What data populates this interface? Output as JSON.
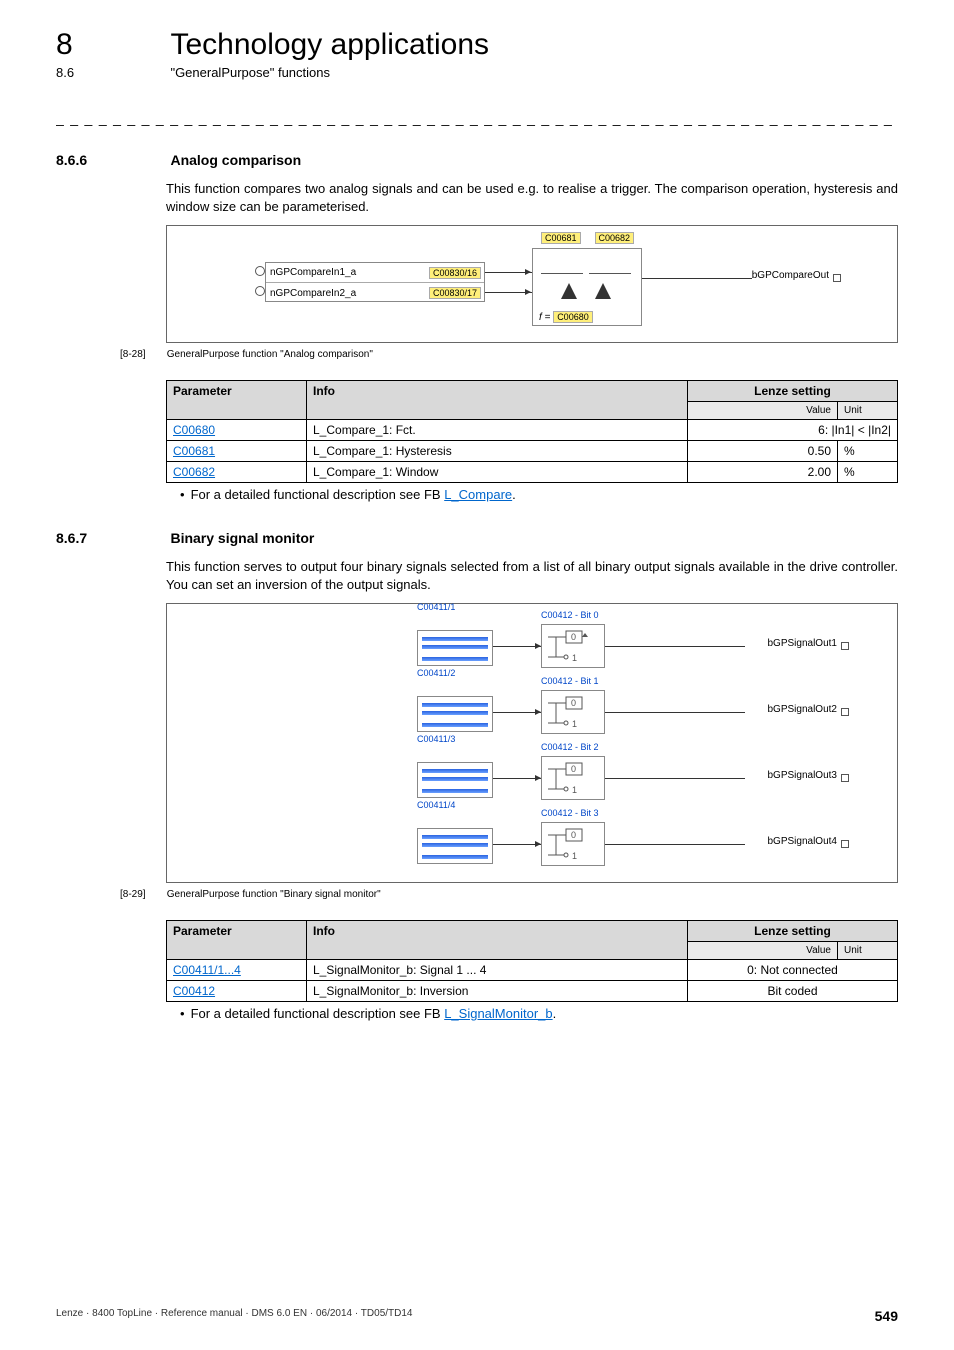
{
  "header": {
    "chapter_num": "8",
    "chapter_title": "Technology applications",
    "sub_num": "8.6",
    "sub_title": "\"GeneralPurpose\" functions"
  },
  "dash_rule": "_ _ _ _ _ _ _ _ _ _ _ _ _ _ _ _ _ _ _ _ _ _ _ _ _ _ _ _ _ _ _ _ _ _ _ _ _ _ _ _ _ _ _ _ _ _ _ _ _ _ _ _ _ _ _ _ _ _ _ _ _ _ _ _",
  "sec1": {
    "num": "8.6.6",
    "title": "Analog comparison",
    "body": "This function compares two analog signals and can be used e.g. to realise a trigger. The comparison operation, hysteresis and window size can be parameterised.",
    "fig": {
      "in1_label": "nGPCompareIn1_a",
      "in1_code": "C00830/16",
      "in2_label": "nGPCompareIn2_a",
      "in2_code": "C00830/17",
      "top_code1": "C00681",
      "top_code2": "C00682",
      "func_code": "C00680",
      "func_prefix": "f =",
      "out_label": "bGPCompareOut"
    },
    "caption_num": "[8-28]",
    "caption_text": "GeneralPurpose function \"Analog comparison\"",
    "table": {
      "hdr_param": "Parameter",
      "hdr_info": "Info",
      "hdr_setting": "Lenze setting",
      "sub_value": "Value",
      "sub_unit": "Unit",
      "rows": [
        {
          "param": "C00680",
          "info": "L_Compare_1: Fct.",
          "value": "6: |In1| < |In2|",
          "unit": ""
        },
        {
          "param": "C00681",
          "info": "L_Compare_1: Hysteresis",
          "value": "0.50",
          "unit": "%"
        },
        {
          "param": "C00682",
          "info": "L_Compare_1: Window",
          "value": "2.00",
          "unit": "%"
        }
      ]
    },
    "bullet_pre": "For a detailed functional description see FB ",
    "bullet_link": "L_Compare",
    "bullet_post": "."
  },
  "sec2": {
    "num": "8.6.7",
    "title": "Binary signal monitor",
    "body": "This function serves to output four binary signals selected from a list of all binary output signals available in the drive controller. You can set an inversion of the output signals.",
    "fig": {
      "rows": [
        {
          "sel": "C00411/1",
          "inv": "C00412 - Bit 0",
          "out": "bGPSignalOut1"
        },
        {
          "sel": "C00411/2",
          "inv": "C00412 - Bit 1",
          "out": "bGPSignalOut2"
        },
        {
          "sel": "C00411/3",
          "inv": "C00412 - Bit 2",
          "out": "bGPSignalOut3"
        },
        {
          "sel": "C00411/4",
          "inv": "C00412 - Bit 3",
          "out": "bGPSignalOut4"
        }
      ]
    },
    "caption_num": "[8-29]",
    "caption_text": "GeneralPurpose function \"Binary signal monitor\"",
    "table": {
      "hdr_param": "Parameter",
      "hdr_info": "Info",
      "hdr_setting": "Lenze setting",
      "sub_value": "Value",
      "sub_unit": "Unit",
      "rows": [
        {
          "param": "C00411/1...4",
          "info": "L_SignalMonitor_b: Signal 1 ... 4",
          "value": "0: Not connected",
          "unit": ""
        },
        {
          "param": "C00412",
          "info": "L_SignalMonitor_b: Inversion",
          "value": "Bit coded",
          "unit": ""
        }
      ]
    },
    "bullet_pre": "For a detailed functional description see FB ",
    "bullet_link": "L_SignalMonitor_b",
    "bullet_post": "."
  },
  "footer": {
    "left": "Lenze · 8400 TopLine · Reference manual · DMS 6.0 EN · 06/2014 · TD05/TD14",
    "page": "549"
  }
}
